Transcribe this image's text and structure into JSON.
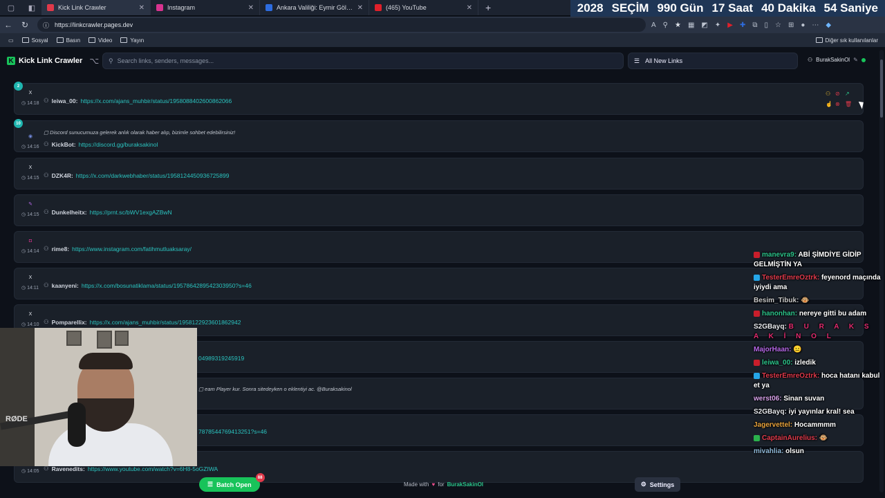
{
  "browser": {
    "tabs": [
      {
        "label": "Kick Link Crawler",
        "color": "#e0394a"
      },
      {
        "label": "Instagram",
        "color": "#d8338f"
      },
      {
        "label": "Ankara Valiliği: Eymir Gölü çevresi",
        "color": "#2d6cdf"
      },
      {
        "label": "(465) YouTube",
        "color": "#e0202a"
      }
    ],
    "url": "https://linkcrawler.pages.dev",
    "bookmarks": [
      "Sosyal",
      "Basın",
      "Video",
      "Yayın"
    ],
    "bookmarks_right": "Diğer sık kullanılanlar"
  },
  "countdown": {
    "year": "2028",
    "label": "SEÇİM",
    "days": "990 Gün",
    "hours": "17 Saat",
    "minutes": "40 Dakika",
    "seconds": "54 Saniye"
  },
  "header": {
    "title": "Kick Link Crawler",
    "search_placeholder": "Search links, senders, messages...",
    "filter": "All New Links",
    "user": "BurakSakinOl"
  },
  "links": [
    {
      "badge": "2",
      "source": "X",
      "time": "14:18",
      "sender": "leiwa_00:",
      "url": "https://x.com/ajans_muhbir/status/1958088402600862066",
      "message": "",
      "actions": true
    },
    {
      "badge": "10",
      "source": "discord",
      "time": "14:16",
      "sender": "KickBot:",
      "url": "https://discord.gg/buraksakinol",
      "message": "Discord sunucumuza gelerek anlık olarak haber alıp, bizimle sohbet edebilirsiniz!"
    },
    {
      "badge": "",
      "source": "X",
      "time": "14:15",
      "sender": "DZK4R:",
      "url": "https://x.com/darkwebhaber/status/1958124450936725899",
      "message": ""
    },
    {
      "badge": "",
      "source": "prnt",
      "time": "14:15",
      "sender": "Dunkelheitx:",
      "url": "https://prnt.sc/bWV1exgAZBwN",
      "message": ""
    },
    {
      "badge": "",
      "source": "instagram",
      "time": "14:14",
      "sender": "rime8:",
      "url": "https://www.instagram.com/fatihmutluaksaray/",
      "message": ""
    },
    {
      "badge": "",
      "source": "X",
      "time": "14:11",
      "sender": "kaanyeni:",
      "url": "https://x.com/bosunatiklama/status/1957864289542303950?s=46",
      "message": ""
    },
    {
      "badge": "",
      "source": "X",
      "time": "14:10",
      "sender": "Pomparellix:",
      "url": "https://x.com/ajans_muhbir/status/1958122923601862942",
      "message": ""
    },
    {
      "badge": "",
      "source": "",
      "time": "",
      "sender": "",
      "url": "04989319245919",
      "message": ""
    },
    {
      "badge": "",
      "source": "",
      "time": "",
      "sender": "",
      "url": "",
      "message": "eam Player kur. Sonra sitedeyken o eklentiyi ac. @Buraksakinol"
    },
    {
      "badge": "",
      "source": "",
      "time": "",
      "sender": "",
      "url": "78785447694132​51?s=46",
      "message": ""
    },
    {
      "badge": "",
      "source": "",
      "time": "14:05",
      "sender": "Ravenedits:",
      "url": "https://www.youtube.com/watch?v=6H8-5oGZIWA",
      "message": ""
    }
  ],
  "chat": [
    {
      "user": "manevra9:",
      "color": "#2bc48a",
      "text": "ABİ ŞİMDİYE GİDİP GELMİŞTİN YA",
      "icon": "red"
    },
    {
      "user": "TesterEmreOztrk:",
      "color": "#e0394a",
      "text": "feyenord maçında iyiydi ama",
      "icon": "blue"
    },
    {
      "user": "Besim_Tibuk:",
      "color": "#c7c7c7",
      "text": "🐵",
      "icon": ""
    },
    {
      "user": "hanonhan:",
      "color": "#2bc48a",
      "text": "nereye gitti bu adam",
      "icon": "red"
    },
    {
      "user": "S2GBayq:",
      "color": "#e8eaee",
      "text": "B U R A K S A K İ N O L",
      "icon": "",
      "fancy": true
    },
    {
      "user": "MajorHaan:",
      "color": "#b667e8",
      "text": "😐",
      "icon": ""
    },
    {
      "user": "leiwa_00:",
      "color": "#2bc48a",
      "text": "izledik",
      "icon": "red"
    },
    {
      "user": "TesterEmreOztrk:",
      "color": "#e0394a",
      "text": "hoca hatanı kabul et ya",
      "icon": "blue"
    },
    {
      "user": "werst06:",
      "color": "#d6a0e8",
      "text": "Sinan suvan",
      "icon": ""
    },
    {
      "user": "S2GBayq:",
      "color": "#e8eaee",
      "text": "iyi yayınlar kral! sea",
      "icon": ""
    },
    {
      "user": "Jagervettel:",
      "color": "#e8a23a",
      "text": "Hocammmm",
      "icon": ""
    },
    {
      "user": "CaptainAurelius:",
      "color": "#e0394a",
      "text": "🐵",
      "icon": "green"
    },
    {
      "user": "mivahlia:",
      "color": "#8fb8d8",
      "text": "olsun",
      "icon": ""
    }
  ],
  "footer": {
    "batch_label": "Batch Open",
    "batch_count": "88",
    "made_with": "Made with",
    "for": "for",
    "author": "BurakSakinOl",
    "settings": "Settings"
  },
  "webcam": {
    "mic_brand": "RØDE"
  }
}
